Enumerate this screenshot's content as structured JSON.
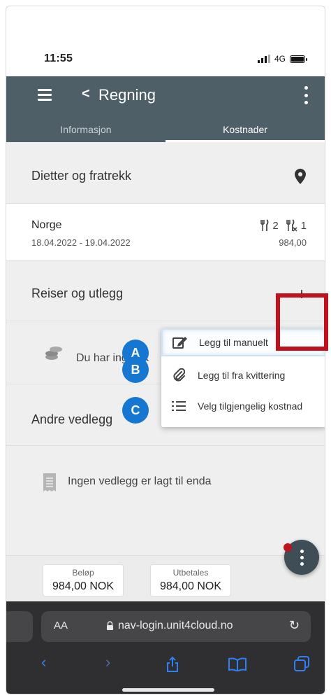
{
  "status_bar": {
    "time": "11:55",
    "network": "4G"
  },
  "app_bar": {
    "back_glyph": "<",
    "title": "Regning"
  },
  "tabs": [
    {
      "label": "Informasjon",
      "active": false
    },
    {
      "label": "Kostnader",
      "active": true
    }
  ],
  "sections": {
    "diet": {
      "label": "Dietter og fratrekk",
      "icon": "location-pin-icon"
    },
    "diet_entry": {
      "country": "Norge",
      "dates": "18.04.2022 - 19.04.2022",
      "meals_count_1": "2",
      "meals_count_2": "1",
      "amount": "984,00"
    },
    "travel": {
      "label": "Reiser og utlegg",
      "add_glyph": "+",
      "empty_text": "Du har ingen k"
    },
    "attachments": {
      "label": "Andre vedlegg",
      "empty_text": "Ingen vedlegg er lagt til enda"
    }
  },
  "popup_menu": {
    "items": [
      {
        "label": "Legg til manuelt",
        "icon": "edit-icon",
        "badge": "A"
      },
      {
        "label": "Legg til fra kvittering",
        "icon": "paperclip-icon",
        "badge": "B"
      },
      {
        "label": "Velg tilgjengelig kostnad",
        "icon": "list-icon",
        "badge": "C"
      }
    ]
  },
  "summary": {
    "amount_label": "Beløp",
    "amount_value": "984,00 NOK",
    "payout_label": "Utbetales",
    "payout_value": "984,00 NOK"
  },
  "browser": {
    "text_size": "AA",
    "url": "nav-login.unit4cloud.no"
  },
  "colors": {
    "app_bar": "#4f5f68",
    "badge": "#1677d2",
    "highlight_box": "#c0121c",
    "safari_bg": "#2f2f31",
    "safari_blue": "#2f7ff5"
  }
}
